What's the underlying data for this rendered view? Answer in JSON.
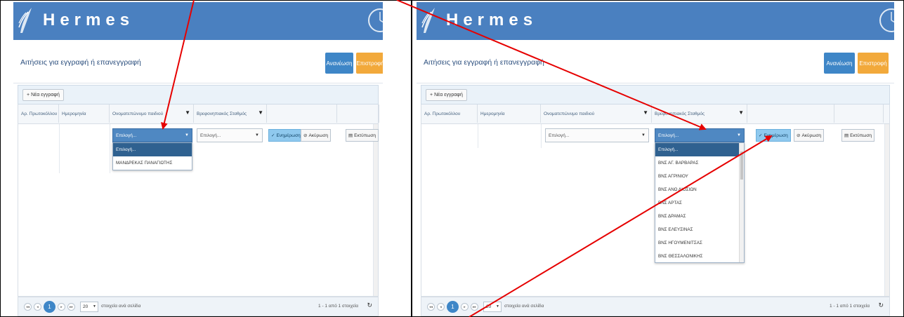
{
  "left": {
    "brand": "Hermes",
    "page_title": "Αιτήσεις για εγγραφή ή επανεγγραφή",
    "buttons": {
      "refresh": "Ανανέωση",
      "return": "Επιστροφή"
    },
    "new_record": "Νέα εγγραφή",
    "columns": [
      "Αρ. Πρωτοκόλλου",
      "Ημερομηνία",
      "Ονοματεπώνυμο παιδιού",
      "Βρεφονηπιακός Σταθμός"
    ],
    "select_child": "Επιλογή...",
    "select_station": "Επιλογή...",
    "save": "Ενημέρωση",
    "cancel": "Ακύρωση",
    "print": "Εκτύπωση",
    "dropdown": [
      "Επιλογή...",
      "ΜΑΝΔΡΕΚΑΣ ΠΑΝΑΓΙΩΤΗΣ"
    ],
    "pager": {
      "current": "1",
      "page_size": "20",
      "per_page": "στοιχεία ανά σελίδα",
      "info": "1 - 1 από 1 στοιχεία"
    }
  },
  "right": {
    "brand": "Hermes",
    "page_title": "Αιτήσεις για εγγραφή ή επανεγγραφή",
    "buttons": {
      "refresh": "Ανανέωση",
      "return": "Επιστροφή"
    },
    "new_record": "Νέα εγγραφή",
    "columns": [
      "Αρ. Πρωτοκόλλου",
      "Ημερομηνία",
      "Ονοματεπώνυμο παιδιού",
      "Βρεφονηπιακός Σταθμός"
    ],
    "select_child": "Επιλογή...",
    "select_station": "Επιλογή...",
    "save": "Ενημέρωση",
    "cancel": "Ακύρωση",
    "print": "Εκτύπωση",
    "dropdown": [
      "Επιλογή...",
      "ΒΝΣ ΑΓ. ΒΑΡΒΑΡΑΣ",
      "ΒΝΣ ΑΓΡΙΝΙΟΥ",
      "ΒΝΣ ΑΝΩ ΛΙΟΣΙΩΝ",
      "ΒΝΣ ΑΡΤΑΣ",
      "ΒΝΣ ΔΡΑΜΑΣ",
      "ΒΝΣ ΕΛΕΥΣΙΝΑΣ",
      "ΒΝΣ ΗΓΟΥΜΕΝΙΤΣΑΣ",
      "ΒΝΣ ΘΕΣΣΑΛΟΝΙΚΗΣ"
    ],
    "pager": {
      "current": "1",
      "page_size": "20",
      "per_page": "στοιχεία ανά σελίδα",
      "info": "1 - 1 από 1 στοιχεία"
    }
  },
  "colors": {
    "header": "#4a80c0",
    "accent": "#3e86c7",
    "orange": "#f2a93b",
    "arrow": "#e60000"
  }
}
